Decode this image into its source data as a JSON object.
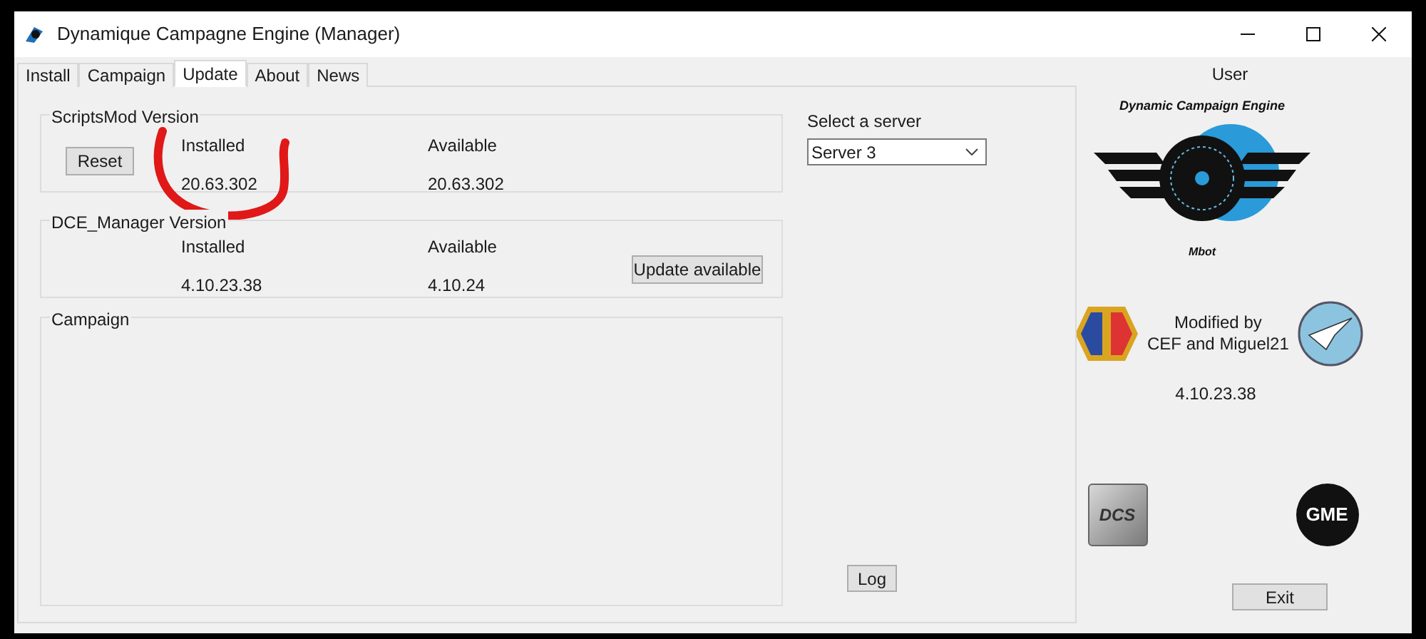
{
  "window": {
    "title": "Dynamique Campagne Engine (Manager)"
  },
  "tabs": [
    {
      "label": "Install",
      "selected": false
    },
    {
      "label": "Campaign",
      "selected": false
    },
    {
      "label": "Update",
      "selected": true
    },
    {
      "label": "About",
      "selected": false
    },
    {
      "label": "News",
      "selected": false
    }
  ],
  "scriptsmod": {
    "title": "ScriptsMod Version",
    "button": "Reset",
    "installed_label": "Installed",
    "installed": "20.63.302",
    "available_label": "Available",
    "available": "20.63.302"
  },
  "manager": {
    "title": "DCE_Manager Version",
    "installed_label": "Installed",
    "installed": "4.10.23.38",
    "available_label": "Available",
    "available": "4.10.24",
    "button": "Update available"
  },
  "campaign": {
    "title": "Campaign"
  },
  "server": {
    "label": "Select a server",
    "value": "Server 3"
  },
  "log_button": "Log",
  "sidebar": {
    "user": "User",
    "logo_title": "Dynamic Campaign Engine",
    "logo_author": "Mbot",
    "credit": "Modified by\nCEF and Miguel21",
    "version": "4.10.23.38",
    "dcs_logo": "DCS",
    "gme_logo": "GME",
    "exit_button": "Exit"
  }
}
